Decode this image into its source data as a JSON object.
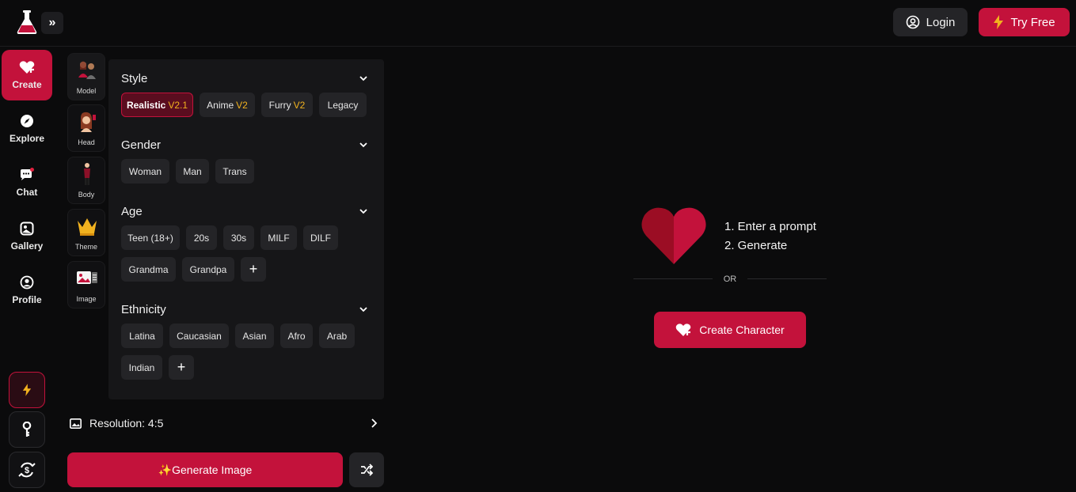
{
  "header": {
    "login_label": "Login",
    "tryfree_label": "Try Free",
    "accent": "#c3123b"
  },
  "nav": {
    "items": [
      {
        "label": "Create",
        "icon": "heart-plus-icon",
        "active": true
      },
      {
        "label": "Explore",
        "icon": "compass-icon"
      },
      {
        "label": "Chat",
        "icon": "chat-bubble-icon"
      },
      {
        "label": "Gallery",
        "icon": "gallery-icon"
      },
      {
        "label": "Profile",
        "icon": "user-circle-icon"
      }
    ],
    "bottom_actions": [
      "flash-icon",
      "key-icon",
      "currency-icon"
    ]
  },
  "categories": [
    {
      "label": "Model"
    },
    {
      "label": "Head"
    },
    {
      "label": "Body"
    },
    {
      "label": "Theme"
    },
    {
      "label": "Image"
    }
  ],
  "panel": {
    "style": {
      "title": "Style",
      "options": [
        {
          "label": "Realistic",
          "ver": "V2.1",
          "selected": true
        },
        {
          "label": "Anime",
          "ver": "V2"
        },
        {
          "label": "Furry",
          "ver": "V2"
        },
        {
          "label": "Legacy",
          "ver": ""
        }
      ]
    },
    "gender": {
      "title": "Gender",
      "options": [
        "Woman",
        "Man",
        "Trans"
      ]
    },
    "age": {
      "title": "Age",
      "options": [
        "Teen (18+)",
        "20s",
        "30s",
        "MILF",
        "DILF",
        "Grandma",
        "Grandpa"
      ],
      "more": "+"
    },
    "ethnicity": {
      "title": "Ethnicity",
      "options": [
        "Latina",
        "Caucasian",
        "Asian",
        "Afro",
        "Arab",
        "Indian"
      ],
      "more": "+"
    }
  },
  "resolution": {
    "label": "Resolution: 4:5"
  },
  "generate": {
    "label": "✨Generate Image"
  },
  "hero": {
    "step1": "1. Enter a prompt",
    "step2": "2. Generate",
    "or": "OR",
    "create_label": "Create Character"
  }
}
